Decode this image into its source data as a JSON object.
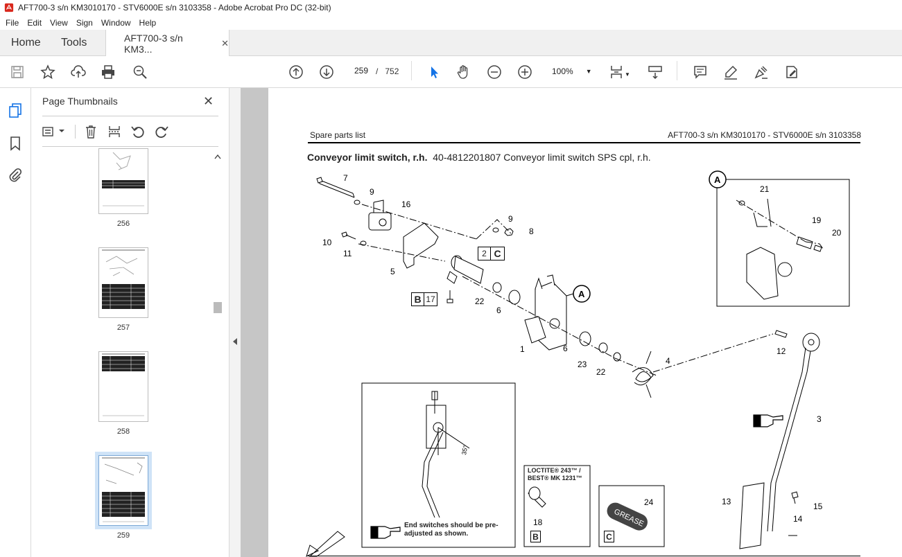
{
  "window": {
    "title": "AFT700-3 s/n KM3010170 - STV6000E s/n 3103358 - Adobe Acrobat Pro DC (32-bit)"
  },
  "menu": [
    "File",
    "Edit",
    "View",
    "Sign",
    "Window",
    "Help"
  ],
  "tabs": {
    "home": "Home",
    "tools": "Tools",
    "document": "AFT700-3 s/n KM3...",
    "close": "✕"
  },
  "toolbar": {
    "page_current": "259",
    "page_separator": "/",
    "page_total": "752",
    "zoom": "100%"
  },
  "panel": {
    "title": "Page Thumbnails",
    "close": "✕",
    "thumbnails": [
      {
        "label": "256"
      },
      {
        "label": "257"
      },
      {
        "label": "258"
      },
      {
        "label": "259",
        "selected": true
      }
    ]
  },
  "document": {
    "header_left": "Spare parts list",
    "header_right": "AFT700-3 s/n KM3010170 - STV6000E s/n 3103358",
    "title_bold": "Conveyor limit switch, r.h.",
    "title_rest": "40-4812201807 Conveyor limit switch SPS cpl, r.h.",
    "callouts": [
      "7",
      "9",
      "16",
      "9",
      "8",
      "10",
      "11",
      "5",
      "2",
      "C",
      "B",
      "17",
      "22",
      "6",
      "1",
      "6",
      "23",
      "22",
      "4",
      "12",
      "3",
      "13",
      "15",
      "14",
      "A",
      "21",
      "19",
      "20",
      "A"
    ],
    "detail_a_label": "A",
    "note_text": "End switches should be pre- adjusted as shown.",
    "angle_label": "35°",
    "loctite_text": "LOCTITE® 243™ / BEST® MK 1231™",
    "loctite_item": "18",
    "loctite_box": "B",
    "grease_text": "GREASE",
    "grease_item": "24",
    "grease_box": "C"
  },
  "colors": {
    "accent": "#1473e6",
    "pdf_red": "#d9281d"
  }
}
